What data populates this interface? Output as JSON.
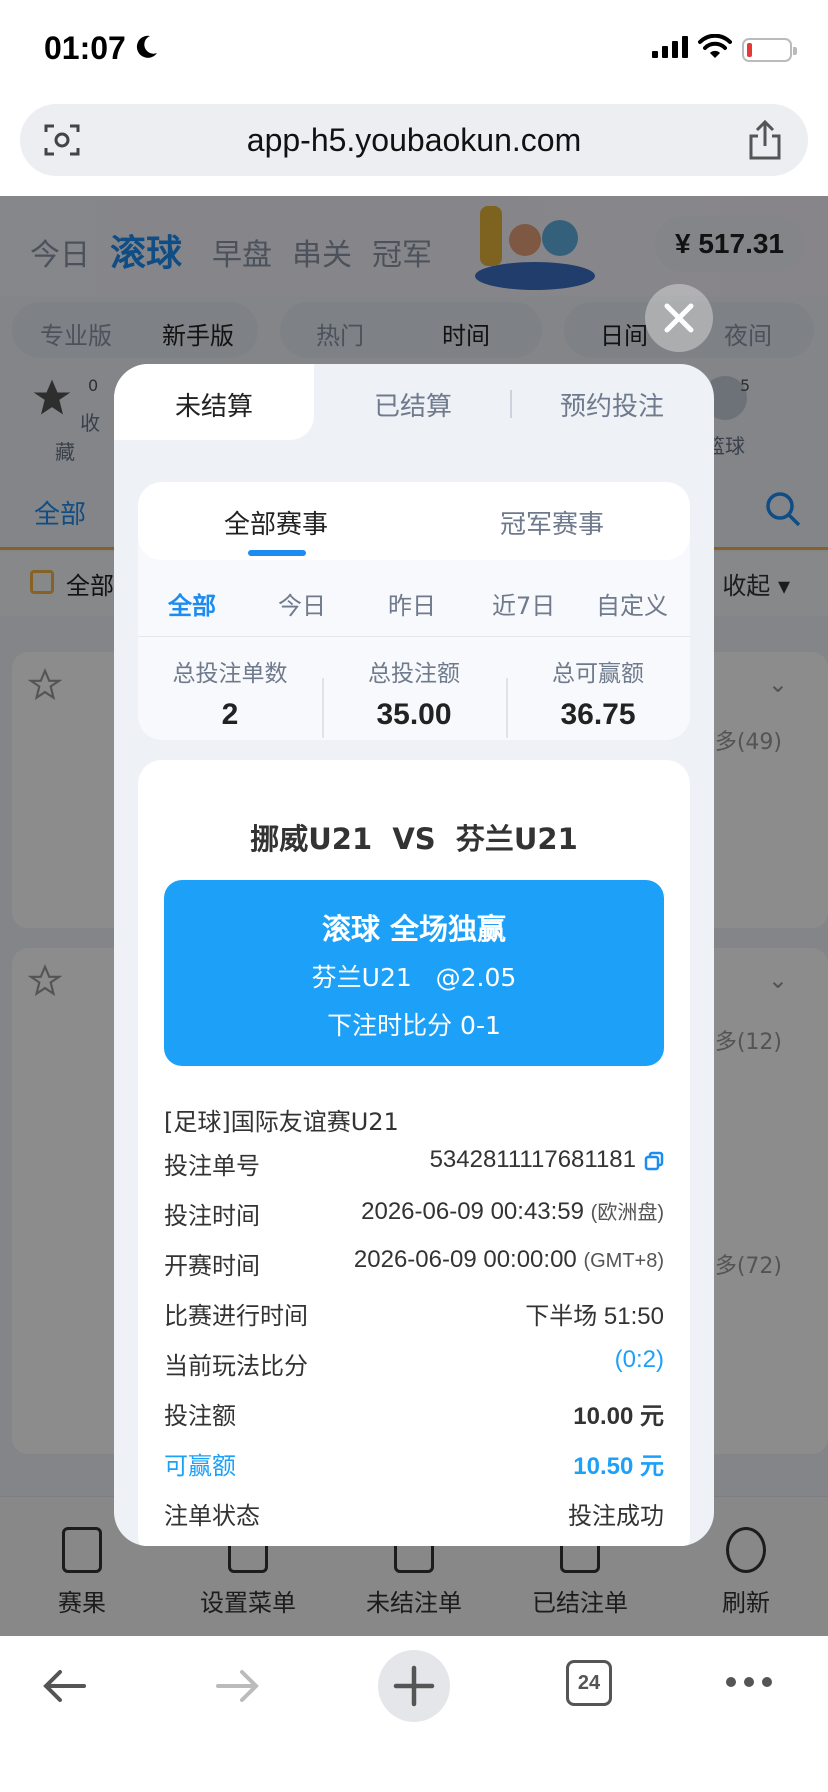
{
  "status_bar": {
    "time": "01:07"
  },
  "browser": {
    "url": "app-h5.youbaokun.com",
    "tab_count": "24"
  },
  "app": {
    "nav_tabs": [
      "今日",
      "滚球",
      "早盘",
      "串关",
      "冠军"
    ],
    "active_nav": "滚球",
    "balance": "¥ 517.31",
    "mode_tabs": [
      "专业版",
      "新手版"
    ],
    "sort_tabs": [
      "热门",
      "时间"
    ],
    "theme_tabs": [
      "日间",
      "夜间"
    ],
    "sports": [
      {
        "label": "收藏",
        "badge": "0"
      },
      {
        "label": "篮球",
        "badge": "5"
      }
    ],
    "all_label": "全部",
    "filter_label": "全部",
    "collapse_label": "收起",
    "more_counts": [
      "多(49)",
      "多(12)",
      "多(72)"
    ],
    "bottom_nav": [
      "赛果",
      "设置菜单",
      "未结注单",
      "已结注单",
      "刷新"
    ]
  },
  "modal": {
    "tabs": [
      "未结算",
      "已结算",
      "预约投注"
    ],
    "active_tab": "未结算",
    "sub_tabs": [
      "全部赛事",
      "冠军赛事"
    ],
    "date_tabs": [
      "全部",
      "今日",
      "昨日",
      "近7日",
      "自定义"
    ],
    "stats": [
      {
        "label": "总投注单数",
        "value": "2"
      },
      {
        "label": "总投注额",
        "value": "35.00"
      },
      {
        "label": "总可赢额",
        "value": "36.75"
      }
    ],
    "bet": {
      "home": "挪威U21",
      "vs": "VS",
      "away": "芬兰U21",
      "type": "滚球 全场独赢",
      "pick": "芬兰U21",
      "odds": "@2.05",
      "score_at_bet": "下注时比分 0-1",
      "league": "[足球]国际友谊赛U21",
      "rows": [
        {
          "key": "投注单号",
          "value": "5342811117681181"
        },
        {
          "key": "投注时间",
          "value": "2026-06-09 00:43:59",
          "note": "(欧洲盘)"
        },
        {
          "key": "开赛时间",
          "value": "2026-06-09 00:00:00",
          "note": "(GMT+8)"
        },
        {
          "key": "比赛进行时间",
          "value": "下半场 51:50"
        },
        {
          "key": "当前玩法比分",
          "value": "(0:2)"
        },
        {
          "key": "投注额",
          "value": "10.00 元"
        },
        {
          "key": "可赢额",
          "value": "10.50 元"
        },
        {
          "key": "注单状态",
          "value": "投注成功"
        }
      ]
    }
  },
  "colors": {
    "accent": "#1d8cf0",
    "bet_box": "#1da1f8",
    "highlight": "#f4b248"
  }
}
